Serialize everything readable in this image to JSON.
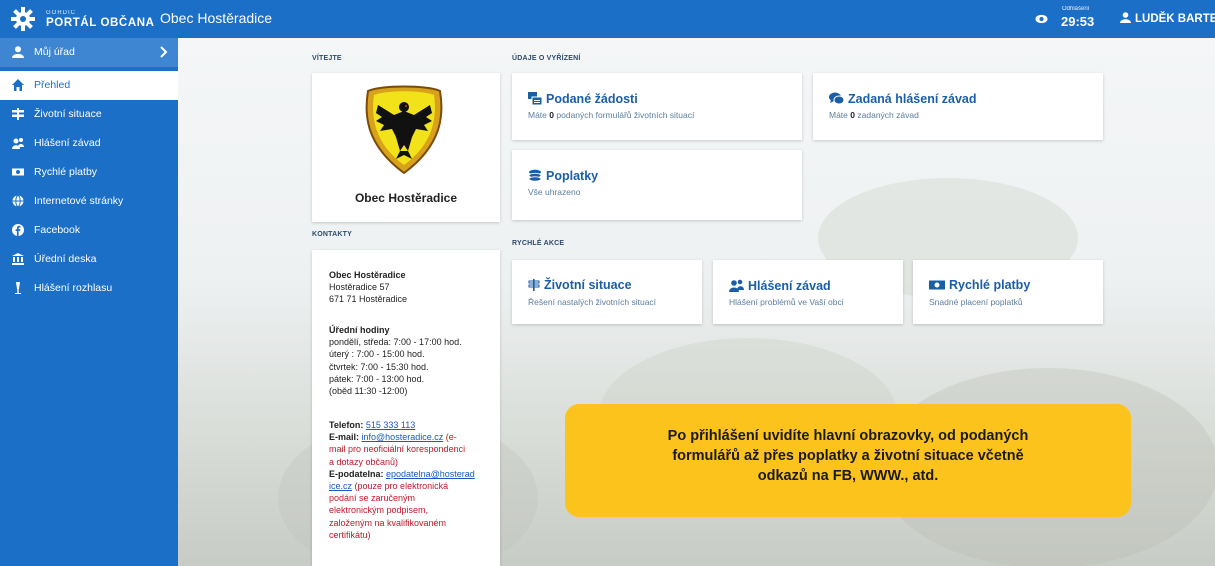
{
  "brand": {
    "small": "GORDIC",
    "big": "PORTÁL OBČANA"
  },
  "header": {
    "title": "Obec Hostěradice",
    "timer_label": "Odhlášení",
    "timer_value": "29:53",
    "user_name": "LUDĚK BARTES"
  },
  "sidebar": {
    "items": [
      {
        "label": "Můj úřad",
        "icon": "user-icon"
      },
      {
        "label": "Přehled",
        "icon": "home-icon"
      },
      {
        "label": "Životní situace",
        "icon": "signpost-icon"
      },
      {
        "label": "Hlášení závad",
        "icon": "report-icon"
      },
      {
        "label": "Rychlé platby",
        "icon": "money-icon"
      },
      {
        "label": "Internetové stránky",
        "icon": "globe-icon"
      },
      {
        "label": "Facebook",
        "icon": "facebook-icon"
      },
      {
        "label": "Úřední deska",
        "icon": "institution-icon"
      },
      {
        "label": "Hlášení rozhlasu",
        "icon": "speaker-icon"
      }
    ]
  },
  "welcome": {
    "label": "VÍTEJTE",
    "name": "Obec Hostěradice"
  },
  "contacts": {
    "label": "KONTAKTY",
    "org_name": "Obec Hostěradice",
    "street": "Hostěradice 57",
    "city": "671 71 Hostěradice",
    "hours_title": "Úřední hodiny",
    "hours": [
      "pondělí, středa: 7:00 - 17:00 hod.",
      "úterý : 7:00 - 15:00 hod.",
      "čtvrtek: 7:00 - 15:30 hod.",
      "pátek: 7:00 - 13:00 hod.",
      "(oběd 11:30 -12:00)"
    ],
    "phone_label": "Telefon:",
    "phone": "515 333 113",
    "email_label": "E-mail:",
    "email": "info@hosteradice.cz",
    "email_note_1": "(e-",
    "email_note_2": "mail pro neoficiální korespondenci",
    "email_note_3": "a dotazy občanů)",
    "epod_label": "E-podatelna:",
    "epod_1": "epodatelna@hosterad",
    "epod_2": "ice.cz",
    "epod_note": [
      "(pouze pro elektronická",
      "podání se zaručeným",
      "elektronickým podpisem,",
      "založeným na kvalifikovaném",
      "certifikátu)"
    ]
  },
  "udaje": {
    "label": "ÚDAJE O VYŘÍZENÍ",
    "podane": {
      "title": "Podané žádosti",
      "pre": "Máte",
      "count": "0",
      "post": "podaných formulářů životních situací"
    },
    "zadana": {
      "title": "Zadaná hlášení závad",
      "pre": "Máte",
      "count": "0",
      "post": "zadaných závad"
    },
    "poplatky": {
      "title": "Poplatky",
      "sub": "Vše uhrazeno"
    }
  },
  "rychle": {
    "label": "RYCHLÉ AKCE",
    "zivotni": {
      "title": "Životní situace",
      "sub": "Řešení nastalých životních situací"
    },
    "hlaseni": {
      "title": "Hlášení závad",
      "sub": "Hlášení problémů ve Vaší obci"
    },
    "platby": {
      "title": "Rychlé platby",
      "sub": "Snadné placení poplatků"
    }
  },
  "banner": {
    "lines": [
      "Po přihlášení uvidíte hlavní obrazovky, od podaných",
      "formulářů až přes poplatky a životní situace včetně",
      "odkazů na FB, WWW., atd."
    ]
  },
  "colors": {
    "primary": "#1b6fc7",
    "banner": "#fdc31d",
    "link": "#1a57c9",
    "note_red": "#c0192b"
  }
}
